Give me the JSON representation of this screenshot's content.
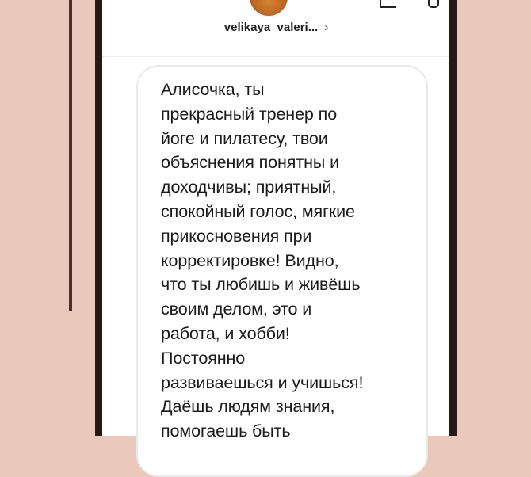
{
  "header": {
    "username": "velikaya_valeri...",
    "chevron": "›",
    "icons": [
      "avatar",
      "video-call-icon",
      "info-icon"
    ]
  },
  "message": {
    "text": "Алисочка, ты\nпрекрасный тренер по\nйоге и пилатесу, твои\nобъяснения понятны и\nдоходчивы; приятный,\nспокойный голос, мягкие\nприкосновения при\nкорректировке! Видно,\nчто ты любишь и живёшь\nсвоим делом, это и\nработа, и хобби!\nПостоянно\nразвиваешься и учишься!\nДаёшь людям знания,\nпомогаешь быть"
  },
  "colors": {
    "background": "#e8c9bb",
    "accent_line": "#4a3027",
    "phone_edge": "#241a17",
    "bubble_border": "#e9e9e9"
  }
}
